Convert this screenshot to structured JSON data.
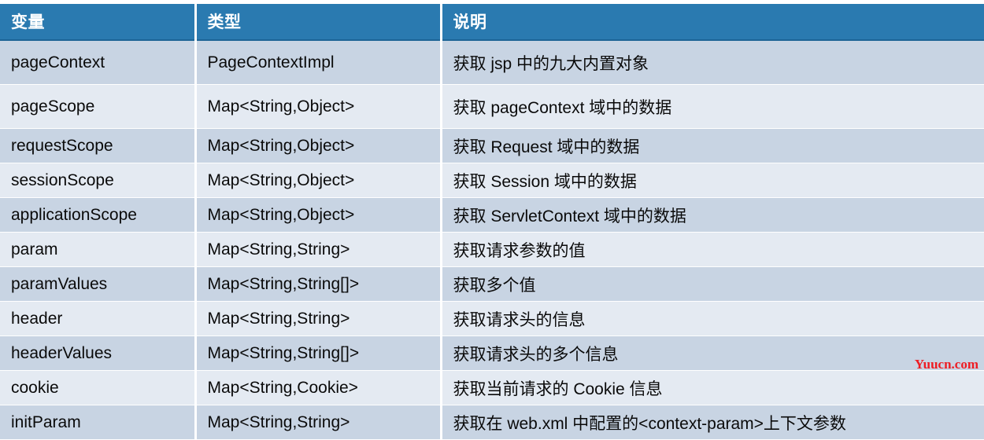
{
  "table": {
    "headers": [
      "变量",
      "类型",
      "说明"
    ],
    "rows": [
      {
        "variable": "pageContext",
        "type": "PageContextImpl",
        "description": "获取 jsp 中的九大内置对象"
      },
      {
        "variable": "pageScope",
        "type": "Map<String,Object>",
        "description": "获取 pageContext 域中的数据"
      },
      {
        "variable": "requestScope",
        "type": "Map<String,Object>",
        "description": "获取 Request 域中的数据"
      },
      {
        "variable": "sessionScope",
        "type": "Map<String,Object>",
        "description": "获取 Session 域中的数据"
      },
      {
        "variable": "applicationScope",
        "type": "Map<String,Object>",
        "description": "获取 ServletContext 域中的数据"
      },
      {
        "variable": "param",
        "type": "Map<String,String>",
        "description": "获取请求参数的值"
      },
      {
        "variable": "paramValues",
        "type": "Map<String,String[]>",
        "description": "获取多个值"
      },
      {
        "variable": "header",
        "type": "Map<String,String>",
        "description": "获取请求头的信息"
      },
      {
        "variable": "headerValues",
        "type": "Map<String,String[]>",
        "description": "获取请求头的多个信息"
      },
      {
        "variable": "cookie",
        "type": "Map<String,Cookie>",
        "description": "获取当前请求的 Cookie 信息"
      },
      {
        "variable": "initParam",
        "type": "Map<String,String>",
        "description": "获取在 web.xml 中配置的<context-param>上下文参数"
      }
    ]
  },
  "watermark": {
    "text": "Yuucn.com",
    "color": "#ee1c23"
  },
  "colors": {
    "header_background": "#2a7ab0",
    "header_text": "#ffffff",
    "row_odd": "#c8d4e3",
    "row_even": "#e4eaf2",
    "cell_text": "#0a0a0a",
    "grid_line": "#ffffff"
  }
}
